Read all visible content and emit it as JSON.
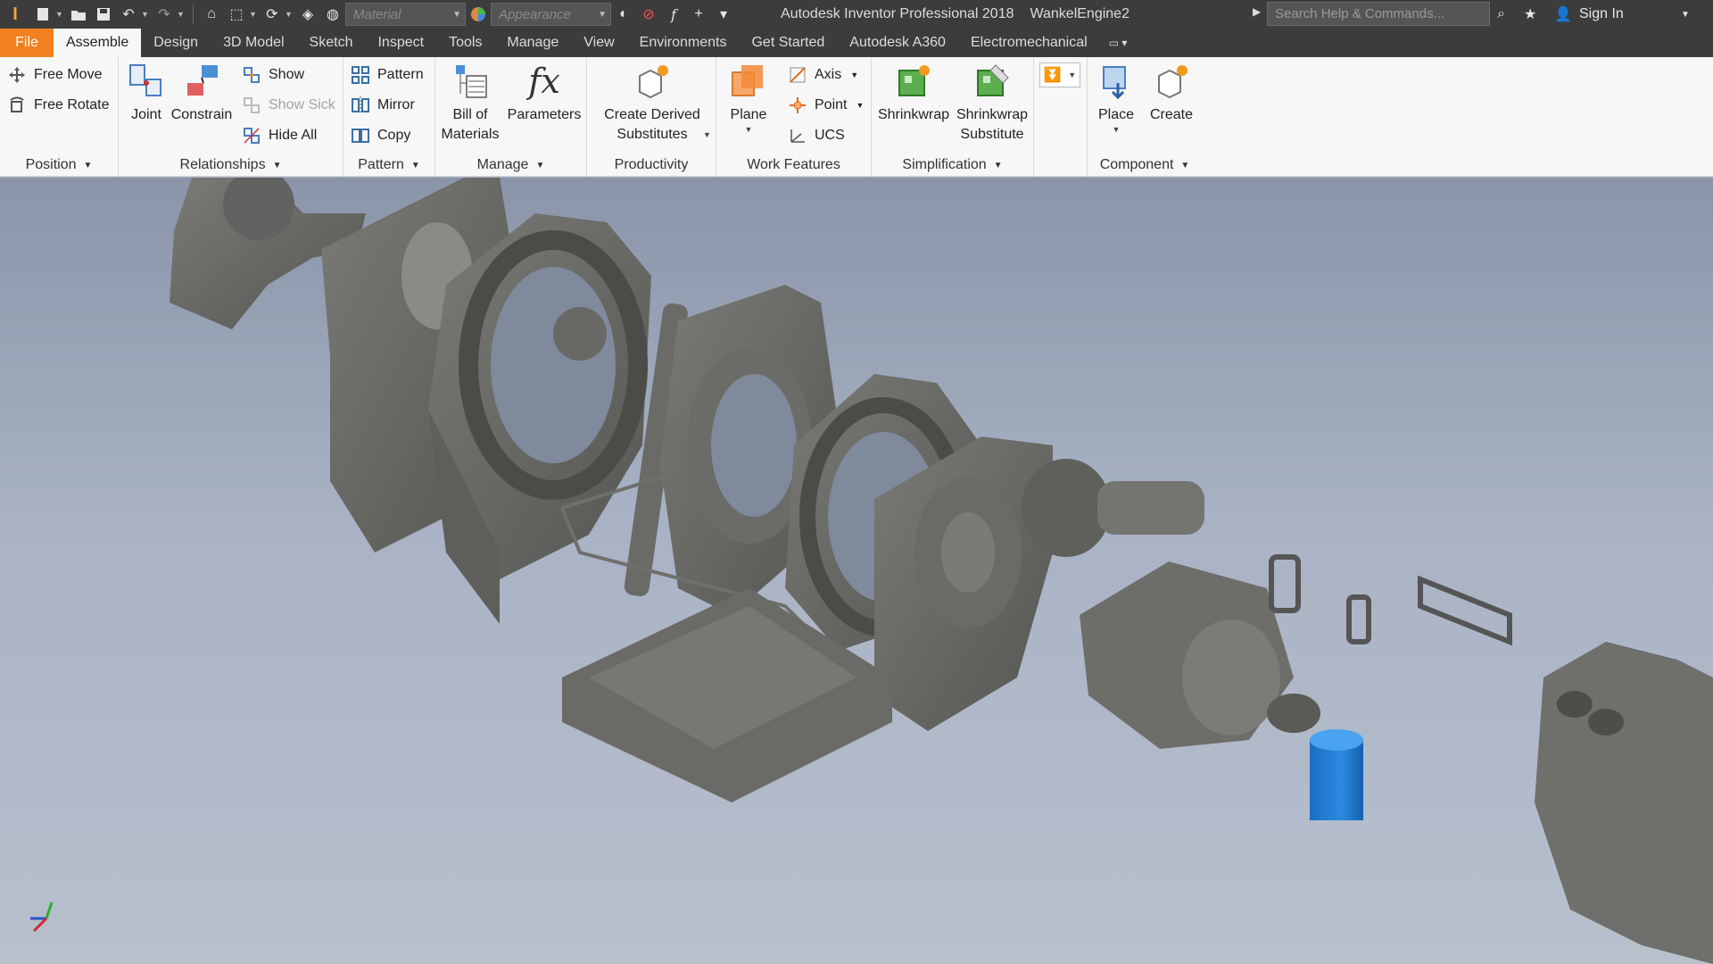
{
  "app": {
    "title": "Autodesk Inventor Professional 2018",
    "document": "WankelEngine2",
    "logo_text": "I",
    "search_placeholder": "Search Help & Commands...",
    "sign_in": "Sign In"
  },
  "quick_access": {
    "material_placeholder": "Material",
    "appearance_placeholder": "Appearance"
  },
  "tabs": [
    {
      "label": "File"
    },
    {
      "label": "Assemble"
    },
    {
      "label": "Design"
    },
    {
      "label": "3D Model"
    },
    {
      "label": "Sketch"
    },
    {
      "label": "Inspect"
    },
    {
      "label": "Tools"
    },
    {
      "label": "Manage"
    },
    {
      "label": "View"
    },
    {
      "label": "Environments"
    },
    {
      "label": "Get Started"
    },
    {
      "label": "Autodesk A360"
    },
    {
      "label": "Electromechanical"
    }
  ],
  "panels": {
    "position": {
      "label": "Position",
      "free_move": "Free Move",
      "free_rotate": "Free Rotate"
    },
    "relationships": {
      "label": "Relationships",
      "joint": "Joint",
      "constrain": "Constrain",
      "show": "Show",
      "show_sick": "Show Sick",
      "hide_all": "Hide All"
    },
    "pattern": {
      "label": "Pattern",
      "pattern": "Pattern",
      "mirror": "Mirror",
      "copy": "Copy"
    },
    "manage": {
      "label": "Manage",
      "bom_line1": "Bill of",
      "bom_line2": "Materials",
      "parameters": "Parameters"
    },
    "productivity": {
      "label": "Productivity",
      "cds_line1": "Create Derived",
      "cds_line2": "Substitutes"
    },
    "work_features": {
      "label": "Work Features",
      "plane": "Plane",
      "axis": "Axis",
      "point": "Point",
      "ucs": "UCS"
    },
    "simplification": {
      "label": "Simplification",
      "shrinkwrap": "Shrinkwrap",
      "sws_line1": "Shrinkwrap",
      "sws_line2": "Substitute"
    },
    "component": {
      "label": "Component",
      "place": "Place",
      "create": "Create"
    }
  },
  "colors": {
    "file_tab": "#f18120",
    "titlebar": "#3c3c3c",
    "ribbon": "#f7f7f7",
    "part_gray": "#6b6b68",
    "filter_blue": "#1f7fd4"
  }
}
